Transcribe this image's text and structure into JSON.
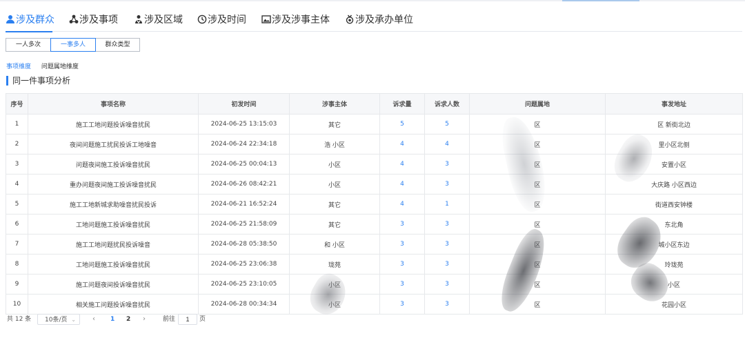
{
  "main_tabs": [
    {
      "label": "涉及群众",
      "icon": "person-icon",
      "active": true
    },
    {
      "label": "涉及事项",
      "icon": "nodes-icon",
      "active": false
    },
    {
      "label": "涉及区域",
      "icon": "people-region-icon",
      "active": false
    },
    {
      "label": "涉及时间",
      "icon": "clock-icon",
      "active": false
    },
    {
      "label": "涉及涉事主体",
      "icon": "image-icon",
      "active": false
    },
    {
      "label": "涉及承办单位",
      "icon": "medal-icon",
      "active": false
    }
  ],
  "segments": [
    {
      "label": "一人多次",
      "active": false
    },
    {
      "label": "一事多人",
      "active": true
    },
    {
      "label": "群众类型",
      "active": false
    }
  ],
  "sub_tabs": [
    {
      "label": "事项维度",
      "active": true
    },
    {
      "label": "问题属地维度",
      "active": false
    }
  ],
  "section_title": "同一件事项分析",
  "table": {
    "headers": [
      "序号",
      "事项名称",
      "初发时间",
      "涉事主体",
      "诉求量",
      "诉求人数",
      "问题属地",
      "事发地址"
    ],
    "rows": [
      {
        "no": "1",
        "name": "施工工地问题投诉噪音扰民",
        "time": "2024-06-25 13:15:03",
        "subject": "其它",
        "count": "5",
        "people": "5",
        "area": "区",
        "address": "区 新街北边"
      },
      {
        "no": "2",
        "name": "夜间问题施工扰民投诉工地噪音",
        "time": "2024-06-24 22:34:18",
        "subject": "浩 小区",
        "count": "4",
        "people": "4",
        "area": "区",
        "address": "里小区北侧"
      },
      {
        "no": "3",
        "name": "问题夜间施工投诉噪音扰民",
        "time": "2024-06-25 00:04:13",
        "subject": "小区",
        "count": "4",
        "people": "3",
        "area": "区",
        "address": "安置小区"
      },
      {
        "no": "4",
        "name": "重办问题夜间施工投诉噪音扰民",
        "time": "2024-06-26 08:42:21",
        "subject": "小区",
        "count": "4",
        "people": "3",
        "area": "区",
        "address": "大庆路 小区西边"
      },
      {
        "no": "5",
        "name": "施工工地新城求助噪音扰民投诉",
        "time": "2024-06-21 16:52:24",
        "subject": "其它",
        "count": "4",
        "people": "1",
        "area": "区",
        "address": "街道西安钟楼"
      },
      {
        "no": "6",
        "name": "工地问题施工投诉噪音扰民",
        "time": "2024-06-25 21:58:09",
        "subject": "其它",
        "count": "3",
        "people": "3",
        "area": "区",
        "address": "东北角"
      },
      {
        "no": "7",
        "name": "施工工地问题扰民投诉噪音",
        "time": "2024-06-28 05:38:50",
        "subject": "和 小区",
        "count": "3",
        "people": "3",
        "area": "区",
        "address": "城小区东边"
      },
      {
        "no": "8",
        "name": "工地问题施工投诉噪音扰民",
        "time": "2024-06-25 23:06:38",
        "subject": "珑苑",
        "count": "3",
        "people": "3",
        "area": "区",
        "address": "玲珑苑"
      },
      {
        "no": "9",
        "name": "施工问题夜间投诉噪音扰民",
        "time": "2024-06-25 23:10:05",
        "subject": "小区",
        "count": "3",
        "people": "3",
        "area": "区",
        "address": "小区"
      },
      {
        "no": "10",
        "name": "相关施工问题投诉噪音扰民",
        "time": "2024-06-28 00:34:34",
        "subject": "小区",
        "count": "3",
        "people": "3",
        "area": "区",
        "address": "花园小区"
      }
    ]
  },
  "pager": {
    "total": "共 12 条",
    "page_size": "10条/页",
    "pages": [
      "1",
      "2"
    ],
    "current_page": "1",
    "jump_prefix": "前往",
    "jump_value": "1",
    "jump_suffix": "页"
  },
  "colors": {
    "accent": "#2a7ff0",
    "border": "#e6e8eb",
    "header_bg": "#f6f7f9"
  }
}
